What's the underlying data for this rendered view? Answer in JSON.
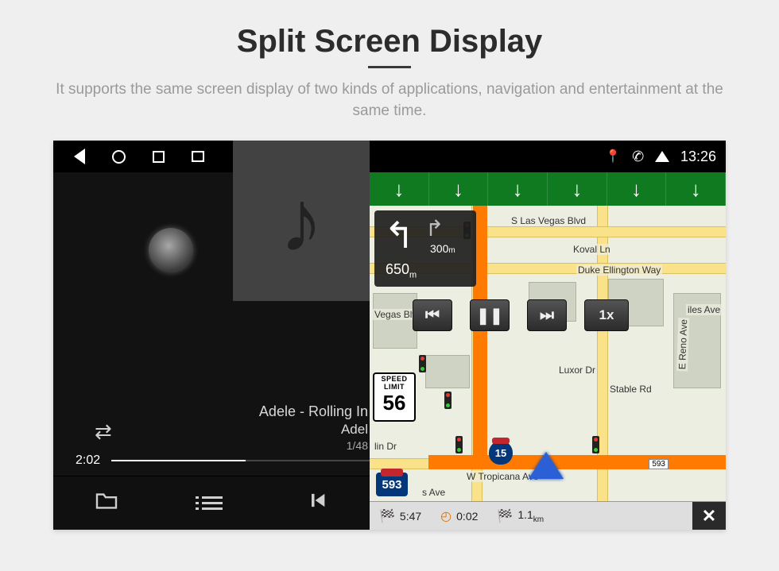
{
  "heading": "Split Screen Display",
  "subheading": "It supports the same screen display of two kinds of applications, navigation and entertainment at the same time.",
  "statusbar": {
    "time": "13:26"
  },
  "player": {
    "track_line1": "Adele - Rolling In",
    "track_line2": "Adel",
    "track_count": "1/48",
    "elapsed": "2:02"
  },
  "nav": {
    "turn_next_m": "300",
    "turn_next_unit": "m",
    "turn_total": "650",
    "turn_total_unit": "m",
    "speed_label1": "SPEED",
    "speed_label2": "LIMIT",
    "speed_value": "56",
    "speed_btn": "1x",
    "hwy_shield": "593",
    "interstate": "15",
    "exit_tag": "593",
    "eta_time": "5:47",
    "eta_dur": "0:02",
    "eta_dist": "1.1",
    "eta_dist_unit": "km",
    "streets": {
      "s_las_vegas": "S Las Vegas Blvd",
      "koval": "Koval Ln",
      "duke": "Duke Ellington Way",
      "vegas_blvd": "Vegas Blvd",
      "luxor": "Luxor Dr",
      "stable": "Stable Rd",
      "reno": "E Reno Ave",
      "tropicana": "W Tropicana Ave",
      "lin_dr": "lin Dr",
      "s_ave": "s Ave",
      "iles_ave": "iles Ave"
    }
  }
}
